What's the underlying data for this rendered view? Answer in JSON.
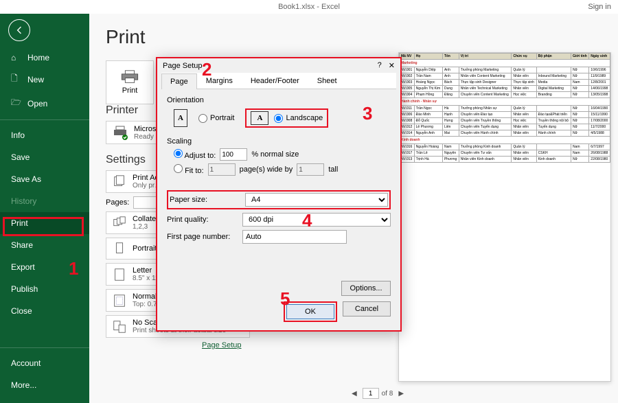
{
  "titlebar": {
    "title": "Book1.xlsx - Excel",
    "signin": "Sign in"
  },
  "sidebar": {
    "home": "Home",
    "new": "New",
    "open": "Open",
    "info": "Info",
    "save": "Save",
    "saveas": "Save As",
    "history": "History",
    "print": "Print",
    "share": "Share",
    "export": "Export",
    "publish": "Publish",
    "close": "Close",
    "account": "Account",
    "more": "More..."
  },
  "content": {
    "title": "Print",
    "print_btn": "Print",
    "printer_head": "Printer",
    "printer_name": "Microso…",
    "printer_status": "Ready",
    "settings_head": "Settings",
    "setting_active": "Print Ac…",
    "setting_active_sub": "Only pr…",
    "pages_lbl": "Pages:",
    "collated": "Collated",
    "collated_sub": "1,2,3",
    "portrait": "Portrait",
    "letter": "Letter",
    "letter_sub": "8.5\" x 11…",
    "margins": "Normal",
    "margins_sub": "Top: 0.75\" Bottom: 0.75\" Left:…",
    "scaling": "No Scaling",
    "scaling_sub": "Print sheets at their actual size",
    "page_setup_link": "Page Setup"
  },
  "dialog": {
    "title": "Page Setup",
    "tabs": {
      "page": "Page",
      "margins": "Margins",
      "hf": "Header/Footer",
      "sheet": "Sheet"
    },
    "orientation_lbl": "Orientation",
    "portrait_lbl": "Portrait",
    "landscape_lbl": "Landscape",
    "scaling_lbl": "Scaling",
    "adjust_lbl": "Adjust to:",
    "adjust_val": "100",
    "adjust_suffix": "% normal size",
    "fit_lbl": "Fit to:",
    "fit_w": "1",
    "fit_mid": "page(s) wide by",
    "fit_h": "1",
    "fit_suffix": "tall",
    "paper_lbl": "Paper size:",
    "paper_val": "A4",
    "quality_lbl": "Print quality:",
    "quality_val": "600 dpi",
    "firstpage_lbl": "First page number:",
    "firstpage_val": "Auto",
    "options": "Options...",
    "ok": "OK",
    "cancel": "Cancel"
  },
  "preview": {
    "headers": [
      "Mã NV",
      "Họ",
      "Tên",
      "Vị trí",
      "Chức vụ",
      "Bộ phận",
      "Giới tính",
      "Ngày sinh"
    ],
    "section1": "Marketing",
    "section2": "Hành chính - Nhân sự",
    "section3": "Kinh doanh",
    "rows1": [
      [
        "NV.001",
        "Nguyễn Diệp",
        "Anh",
        "Trưởng phòng Marketing",
        "Quản lý",
        "",
        "Nữ",
        "10/6/1996"
      ],
      [
        "NV.002",
        "Trần Nam",
        "Anh",
        "Nhân viên Content Marketing",
        "Nhân viên",
        "Inbound Marketing",
        "Nữ",
        "11/9/1989"
      ],
      [
        "NV.003",
        "Hoàng Ngọc",
        "Bách",
        "Thực tập sinh Designer",
        "Thực tập sinh",
        "Media",
        "Nam",
        "12/8/2001"
      ],
      [
        "NV.005",
        "Nguyễn Thị Kim",
        "Dung",
        "Nhân viên Technical Marketing",
        "Nhân viên",
        "Digital Marketing",
        "Nữ",
        "14/06/1998"
      ],
      [
        "NV.004",
        "Phạm Hồng",
        "Đăng",
        "Chuyên viên Content Marketing",
        "Học việc",
        "Branding",
        "Nữ",
        "13/05/1998"
      ]
    ],
    "rows2": [
      [
        "NV.011",
        "Trần Ngọc",
        "Hà",
        "Trưởng phòng Nhân sự",
        "Quản lý",
        "",
        "Nữ",
        "16/04/1990"
      ],
      [
        "NV.006",
        "Đào Minh",
        "Hạnh",
        "Chuyên viên Đào tạo",
        "Nhân viên",
        "Đào tạo&Phát triển",
        "Nữ",
        "15/11/1990"
      ],
      [
        "NV.008",
        "Đỗ Quốc",
        "Hưng",
        "Chuyên viên Truyền thông",
        "Học việc",
        "Truyền thông nội bộ",
        "Nữ",
        "17/08/2000"
      ],
      [
        "NV.012",
        "Lê Phương",
        "Liên",
        "Chuyên viên Tuyển dụng",
        "Nhân viên",
        "Tuyển dụng",
        "Nữ",
        "11/7/2000"
      ],
      [
        "NV.014",
        "Nguyễn Anh",
        "Mai",
        "Chuyên viên Hành chính",
        "Nhân viên",
        "Hành chính",
        "Nữ",
        "4/5/1988"
      ]
    ],
    "rows3": [
      [
        "NV.016",
        "Nguyễn Hoàng",
        "Nam",
        "Trưởng phòng Kinh doanh",
        "Quản lý",
        "",
        "Nam",
        "6/7/1997"
      ],
      [
        "NV.017",
        "Trần Lê",
        "Nguyên",
        "Chuyên viên Tư vấn",
        "Nhân viên",
        "CSKH",
        "Nam",
        "26/08/1988"
      ],
      [
        "NV.013",
        "Trịnh Hà",
        "Phương",
        "Nhân viên Kinh doanh",
        "Nhân viên",
        "Kinh doanh",
        "Nữ",
        "22/08/1980"
      ]
    ],
    "page_current": "1",
    "page_total": "of 8"
  },
  "anno": {
    "n1": "1",
    "n2": "2",
    "n3": "3",
    "n4": "4",
    "n5": "5"
  }
}
